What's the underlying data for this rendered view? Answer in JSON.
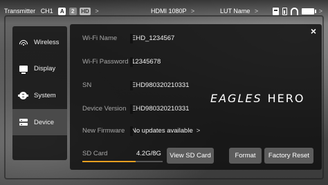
{
  "topbar": {
    "transmitter_label": "Transmitter",
    "channel": "CH1",
    "badge_a": "A",
    "badge_2": "2",
    "badge_hd": "HD",
    "hdmi": "HDMI 1080P",
    "lut": "LUT Name",
    "chevron": ">",
    "icons": [
      "recorder-icon",
      "small-battery-icon",
      "headphone-icon",
      "battery-icon",
      "chevron-right-icon"
    ]
  },
  "sidebar": {
    "items": [
      {
        "label": "Wireless",
        "icon": "wifi-icon",
        "active": false
      },
      {
        "label": "Display",
        "icon": "display-icon",
        "active": false
      },
      {
        "label": "System",
        "icon": "gear-icon",
        "active": false
      },
      {
        "label": "Device",
        "icon": "device-icon",
        "active": true
      }
    ]
  },
  "panel": {
    "close": "×",
    "rows": [
      {
        "label": "Wi-Fi Name",
        "value": "EHD_1234567"
      },
      {
        "label": "Wi-Fi Password",
        "value": "12345678"
      },
      {
        "label": "SN",
        "value": "EHD980320210331"
      },
      {
        "label": "Device Version",
        "value": "EHD980320210331"
      },
      {
        "label": "New Firmware",
        "value": "No updates available",
        "chevron": ">"
      }
    ],
    "logo": {
      "word1": "EAGLES",
      "word2": "HERO"
    },
    "sd": {
      "label": "SD Card",
      "value": "4.2G/8G",
      "used_fraction": 0.66
    },
    "buttons": {
      "view_sd": "View SD Card",
      "format": "Format",
      "factory_reset": "Factory Reset"
    }
  },
  "colors": {
    "accent": "#e8a020",
    "panel_bg": "#121212",
    "active_item": "#4a4a4a",
    "button_bg": "#5c5c5c"
  }
}
